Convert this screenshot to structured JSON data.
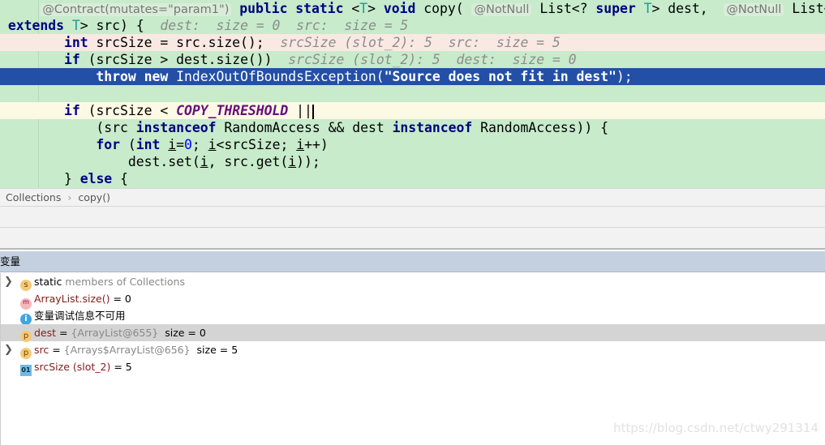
{
  "editor": {
    "lines": [
      {
        "style": "",
        "indent": "     ",
        "tokens": [
          {
            "t": "@Contract(mutates=\"param1\")",
            "c": "ann"
          },
          {
            "t": " "
          },
          {
            "t": "public static",
            "c": "kw"
          },
          {
            "t": " <"
          },
          {
            "t": "T",
            "c": "tp"
          },
          {
            "t": "> "
          },
          {
            "t": "void",
            "c": "kw"
          },
          {
            "t": " copy( "
          },
          {
            "t": "@NotNull",
            "c": "ann"
          },
          {
            "t": " List<? "
          },
          {
            "t": "super",
            "c": "kw"
          },
          {
            "t": " "
          },
          {
            "t": "T",
            "c": "tp"
          },
          {
            "t": "> dest,  "
          },
          {
            "t": "@NotNull",
            "c": "ann"
          },
          {
            "t": " List<?"
          }
        ]
      },
      {
        "style": "",
        "indent": " ",
        "tokens": [
          {
            "t": "extends",
            "c": "kw"
          },
          {
            "t": " "
          },
          {
            "t": "T",
            "c": "tp"
          },
          {
            "t": "> src) {  "
          },
          {
            "t": "dest:  size = 0  src:  size = 5",
            "c": "hint"
          }
        ]
      },
      {
        "style": "pink",
        "indent": "        ",
        "tokens": [
          {
            "t": "int",
            "c": "kw"
          },
          {
            "t": " srcSize = src.size();  "
          },
          {
            "t": "srcSize (slot_2): 5  src:  size = 5",
            "c": "hint"
          }
        ]
      },
      {
        "style": "",
        "indent": "        ",
        "tokens": [
          {
            "t": "if",
            "c": "kw"
          },
          {
            "t": " (srcSize > dest.size())  "
          },
          {
            "t": "srcSize (slot_2): 5  dest:  size = 0",
            "c": "hint"
          }
        ]
      },
      {
        "style": "blue",
        "indent": "            ",
        "tokens": [
          {
            "t": "throw new",
            "c": "kw"
          },
          {
            "t": " IndexOutOfBoundsException("
          },
          {
            "t": "\"Source does not fit in dest\"",
            "c": "str"
          },
          {
            "t": ");"
          }
        ]
      },
      {
        "style": "",
        "indent": "",
        "tokens": []
      },
      {
        "style": "yellow",
        "indent": "        ",
        "tokens": [
          {
            "t": "if",
            "c": "kw"
          },
          {
            "t": " (srcSize < "
          },
          {
            "t": "COPY_THRESHOLD",
            "c": "const"
          },
          {
            "t": " ||"
          },
          {
            "t": "",
            "c": "caret"
          }
        ]
      },
      {
        "style": "",
        "indent": "            ",
        "tokens": [
          {
            "t": "(src "
          },
          {
            "t": "instanceof",
            "c": "kw"
          },
          {
            "t": " RandomAccess && dest "
          },
          {
            "t": "instanceof",
            "c": "kw"
          },
          {
            "t": " RandomAccess)) {"
          }
        ]
      },
      {
        "style": "",
        "indent": "            ",
        "tokens": [
          {
            "t": "for",
            "c": "kw"
          },
          {
            "t": " ("
          },
          {
            "t": "int",
            "c": "kw"
          },
          {
            "t": " "
          },
          {
            "t": "i",
            "c": "ul"
          },
          {
            "t": "="
          },
          {
            "t": "0",
            "c": "num"
          },
          {
            "t": "; "
          },
          {
            "t": "i",
            "c": "ul"
          },
          {
            "t": "<srcSize; "
          },
          {
            "t": "i",
            "c": "ul"
          },
          {
            "t": "++)"
          }
        ]
      },
      {
        "style": "",
        "indent": "                ",
        "tokens": [
          {
            "t": "dest.set("
          },
          {
            "t": "i",
            "c": "ul"
          },
          {
            "t": ", src.get("
          },
          {
            "t": "i",
            "c": "ul"
          },
          {
            "t": "));"
          }
        ]
      },
      {
        "style": "",
        "indent": "        ",
        "tokens": [
          {
            "t": "} "
          },
          {
            "t": "else",
            "c": "kw"
          },
          {
            "t": " {"
          }
        ]
      }
    ]
  },
  "breadcrumb": {
    "items": [
      "Collections",
      "copy()"
    ],
    "separator": "›"
  },
  "variables": {
    "title": "变量",
    "rows": [
      {
        "expand": true,
        "icon": "s",
        "name": "static",
        "rest": " members of Collections",
        "restGray": true,
        "sel": false
      },
      {
        "expand": false,
        "icon": "m",
        "name": "ArrayList.size()",
        "rest": " = 0",
        "sel": false
      },
      {
        "expand": false,
        "icon": "i",
        "name": "变量调试信息不可用",
        "rest": "",
        "plain": true,
        "sel": false
      },
      {
        "expand": false,
        "icon": "p",
        "name": "dest",
        "rest": " = ",
        "obj": "{ArrayList@655}",
        "extra": "  size = 0",
        "sel": true
      },
      {
        "expand": true,
        "icon": "p",
        "name": "src",
        "rest": " = ",
        "obj": "{Arrays$ArrayList@656}",
        "extra": "  size = 5",
        "sel": false
      },
      {
        "expand": false,
        "icon": "o",
        "name": "srcSize (slot_2)",
        "rest": " = 5",
        "sel": false
      }
    ]
  },
  "watermark": "https://blog.csdn.net/ctwy291314",
  "colors": {
    "editor_bg": "#c7ebcb",
    "exec_line": "#2350a6",
    "breakpoint_line": "#fae8e3",
    "caret_line": "#fdf9e4"
  }
}
